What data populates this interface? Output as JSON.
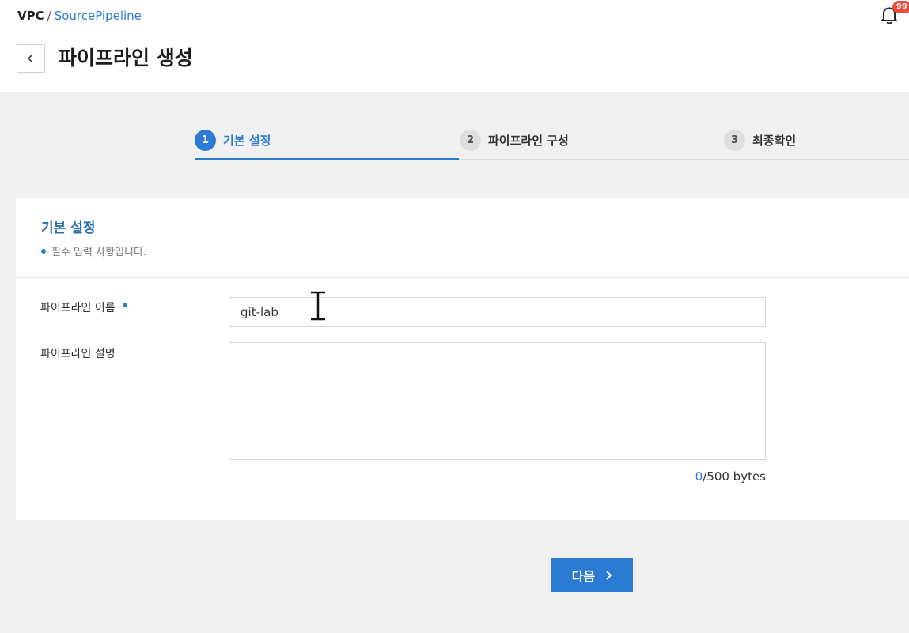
{
  "breadcrumb": {
    "root": "VPC",
    "separator": "/",
    "current": "SourcePipeline"
  },
  "notifications": {
    "icon": "bell-icon",
    "count": "99"
  },
  "page": {
    "back_icon": "chevron-left-icon",
    "title": "파이프라인 생성"
  },
  "steps": [
    {
      "num": "1",
      "label": "기본 설정",
      "active": true
    },
    {
      "num": "2",
      "label": "파이프라인 구성",
      "active": false
    },
    {
      "num": "3",
      "label": "최종확인",
      "active": false
    }
  ],
  "section": {
    "title": "기본 설정",
    "required_note": "필수 입력 사항입니다."
  },
  "form": {
    "name_label": "파이프라인 이름",
    "name_value": "git-lab",
    "desc_label": "파이프라인 설명",
    "desc_value": "",
    "counter_current": "0",
    "counter_max": "/500 bytes"
  },
  "actions": {
    "next_label": "다음",
    "next_icon": "chevron-right-icon"
  },
  "colors": {
    "accent": "#2b7bd4",
    "badge": "#e84b3c",
    "background": "#f0f0f0"
  }
}
